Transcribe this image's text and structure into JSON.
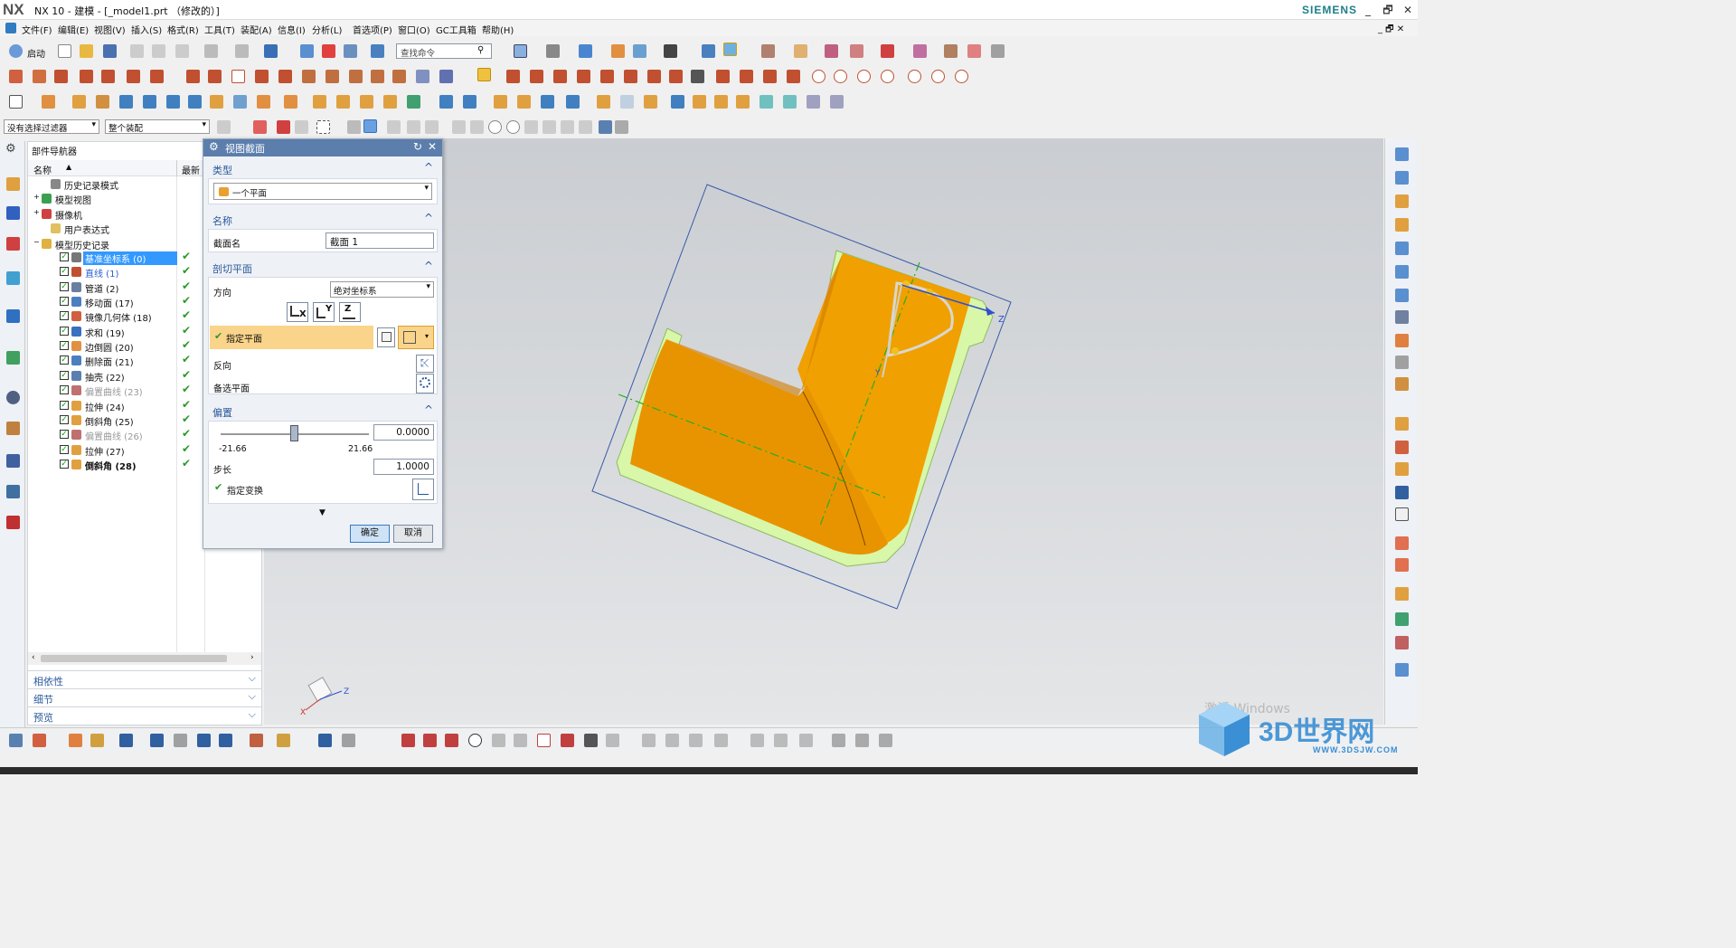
{
  "window": {
    "logo": "NX",
    "title": "NX 10 - 建模 - [_model1.prt （修改的）]",
    "brand": "SIEMENS",
    "minimize": "_",
    "restore": "🗗",
    "close": "✕"
  },
  "menu": [
    "文件(F)",
    "编辑(E)",
    "视图(V)",
    "插入(S)",
    "格式(R)",
    "工具(T)",
    "装配(A)",
    "信息(I)",
    "分析(L)",
    "首选项(P)",
    "窗口(O)",
    "GC工具箱",
    "帮助(H)"
  ],
  "toolbar": {
    "start_label": "启动",
    "search_placeholder": "查找命令",
    "filter_value": "没有选择过滤器",
    "assembly_value": "整个装配"
  },
  "navigator": {
    "title": "部件导航器",
    "col_name": "名称",
    "col_latest": "最新",
    "top_items": [
      {
        "label": "历史记录模式"
      },
      {
        "label": "模型视图"
      },
      {
        "label": "摄像机"
      },
      {
        "label": "用户表达式"
      },
      {
        "label": "模型历史记录"
      }
    ],
    "features": [
      {
        "label": "基准坐标系 (0)",
        "style": "selected"
      },
      {
        "label": "直线 (1)",
        "style": "blue"
      },
      {
        "label": "管道 (2)",
        "style": "normal"
      },
      {
        "label": "移动面 (17)",
        "style": "normal"
      },
      {
        "label": "镜像几何体 (18)",
        "style": "normal"
      },
      {
        "label": "求和 (19)",
        "style": "normal"
      },
      {
        "label": "边倒圆 (20)",
        "style": "normal"
      },
      {
        "label": "删除面 (21)",
        "style": "normal"
      },
      {
        "label": "抽壳 (22)",
        "style": "normal"
      },
      {
        "label": "偏置曲线 (23)",
        "style": "grey"
      },
      {
        "label": "拉伸 (24)",
        "style": "normal"
      },
      {
        "label": "倒斜角 (25)",
        "style": "normal"
      },
      {
        "label": "偏置曲线 (26)",
        "style": "grey"
      },
      {
        "label": "拉伸 (27)",
        "style": "normal"
      },
      {
        "label": "倒斜角 (28)",
        "style": "bold"
      }
    ],
    "sections": [
      "相依性",
      "细节",
      "预览"
    ]
  },
  "dialog": {
    "title": "视图截面",
    "type_header": "类型",
    "type_value": "一个平面",
    "name_header": "名称",
    "section_name_label": "截面名",
    "section_name_value": "截面 1",
    "cut_header": "剖切平面",
    "direction_label": "方向",
    "direction_value": "绝对坐标系",
    "axis_x": "X",
    "axis_y": "Y",
    "axis_z": "Z",
    "specify_plane": "指定平面",
    "reverse_label": "反向",
    "alt_plane_label": "备选平面",
    "offset_header": "偏置",
    "offset_value": "0.0000",
    "slider_min": "-21.66",
    "slider_max": "21.66",
    "slider_position": 0.5,
    "step_label": "步长",
    "step_value": "1.0000",
    "specify_transform": "指定变换",
    "ok": "确定",
    "cancel": "取消"
  },
  "viewport": {
    "triad_z": "Z",
    "triad_x": "X",
    "handle_z": "Z",
    "handle_y": "Y"
  },
  "watermark": {
    "text": "3D世界网",
    "url": "WWW.3DSJW.COM",
    "windows": "激活 Windows"
  },
  "colors": {
    "accent": "#5b7eac",
    "part_orange": "#f0a000",
    "part_green": "#d8f7a8"
  }
}
